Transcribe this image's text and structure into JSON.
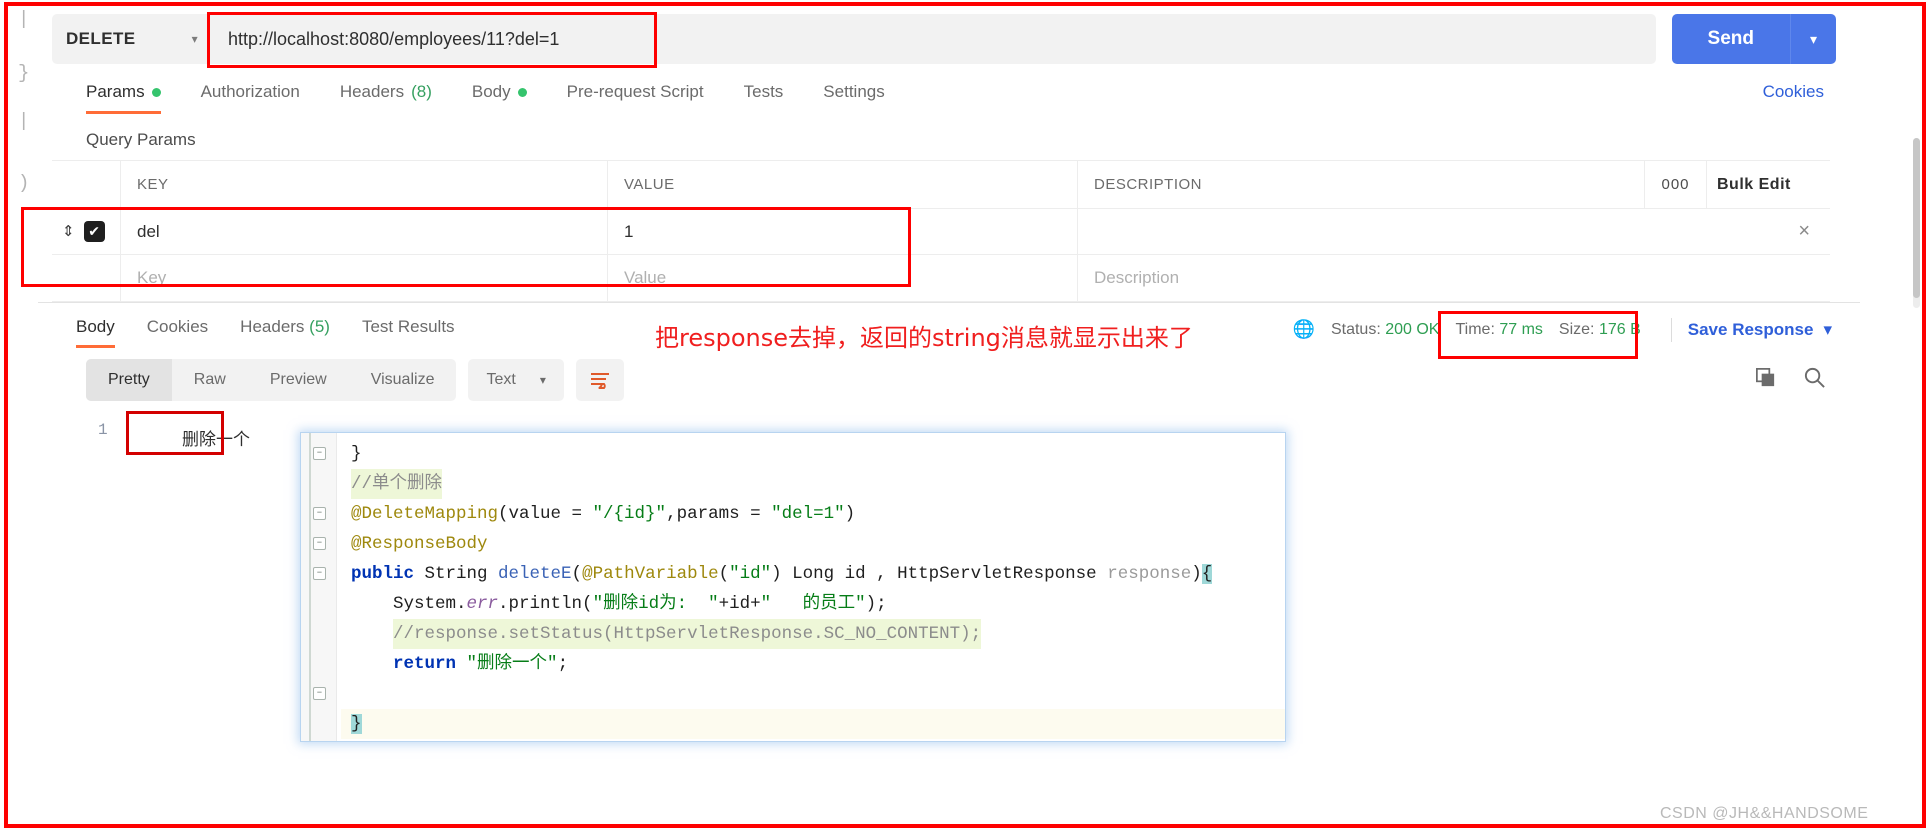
{
  "request": {
    "method": "DELETE",
    "method_caret": "chevron-down",
    "url": "http://localhost:8080/employees/11?del=1",
    "send_label": "Send",
    "tabs": [
      {
        "label": "Params",
        "badge": "dot",
        "active": true
      },
      {
        "label": "Authorization",
        "badge": "",
        "active": false
      },
      {
        "label": "Headers",
        "count": "(8)",
        "badge": "count",
        "active": false
      },
      {
        "label": "Body",
        "badge": "dot",
        "active": false
      },
      {
        "label": "Pre-request Script",
        "badge": "",
        "active": false
      },
      {
        "label": "Tests",
        "badge": "",
        "active": false
      },
      {
        "label": "Settings",
        "badge": "",
        "active": false
      }
    ],
    "cookies_link": "Cookies"
  },
  "query_params": {
    "section_title": "Query Params",
    "columns": {
      "key": "KEY",
      "value": "VALUE",
      "description": "DESCRIPTION"
    },
    "dots_label": "000",
    "bulk_edit_label": "Bulk Edit",
    "rows": [
      {
        "checked": true,
        "key": "del",
        "value": "1",
        "description": "",
        "remove": "×"
      }
    ],
    "placeholder_row": {
      "key": "Key",
      "value": "Value",
      "description": "Description"
    }
  },
  "response": {
    "tabs": [
      {
        "label": "Body",
        "active": true
      },
      {
        "label": "Cookies",
        "active": false
      },
      {
        "label": "Headers",
        "count": "(5)",
        "active": false
      },
      {
        "label": "Test Results",
        "active": false
      }
    ],
    "status": {
      "globe_icon": "globe-icon",
      "status_label": "Status:",
      "status_value": "200 OK",
      "time_label": "Time:",
      "time_value": "77 ms",
      "size_label": "Size:",
      "size_value": "176 B"
    },
    "save_response_label": "Save Response",
    "view_modes": [
      {
        "label": "Pretty",
        "active": true
      },
      {
        "label": "Raw",
        "active": false
      },
      {
        "label": "Preview",
        "active": false
      },
      {
        "label": "Visualize",
        "active": false
      }
    ],
    "format": "Text",
    "wrap_icon": "wrap-lines-icon",
    "copy_icon": "copy-icon",
    "search_icon": "search-icon",
    "body": {
      "line_number": "1",
      "text": "删除一个"
    }
  },
  "annotation": {
    "note": "把response去掉，返回的string消息就显示出来了"
  },
  "code_editor": {
    "lines": [
      {
        "tokens": [
          {
            "t": "}",
            "c": "plain"
          }
        ]
      },
      {
        "highlight": "green",
        "tokens": [
          {
            "t": "//单个删除",
            "c": "cmt"
          }
        ]
      },
      {
        "tokens": [
          {
            "t": "@DeleteMapping",
            "c": "ann"
          },
          {
            "t": "(value = ",
            "c": "plain"
          },
          {
            "t": "\"/{id}\"",
            "c": "str"
          },
          {
            "t": ",params = ",
            "c": "plain"
          },
          {
            "t": "\"del=1\"",
            "c": "str"
          },
          {
            "t": ")",
            "c": "plain"
          }
        ]
      },
      {
        "tokens": [
          {
            "t": "@ResponseBody",
            "c": "ann"
          }
        ]
      },
      {
        "tokens": [
          {
            "t": "public",
            "c": "kw"
          },
          {
            "t": " String ",
            "c": "plain"
          },
          {
            "t": "deleteE",
            "c": "meth"
          },
          {
            "t": "(",
            "c": "plain"
          },
          {
            "t": "@PathVariable",
            "c": "ann"
          },
          {
            "t": "(",
            "c": "plain"
          },
          {
            "t": "\"id\"",
            "c": "str"
          },
          {
            "t": ") Long id , HttpServletResponse ",
            "c": "plain"
          },
          {
            "t": "response",
            "c": "param"
          },
          {
            "t": ")",
            "c": "plain"
          },
          {
            "t": "{",
            "c": "caret"
          }
        ]
      },
      {
        "indent": 1,
        "tokens": [
          {
            "t": "System.",
            "c": "plain"
          },
          {
            "t": "err",
            "c": "fld"
          },
          {
            "t": ".println(",
            "c": "plain"
          },
          {
            "t": "\"删除id为:  \"",
            "c": "str"
          },
          {
            "t": "+id+",
            "c": "plain"
          },
          {
            "t": "\"   的员工\"",
            "c": "str"
          },
          {
            "t": ");",
            "c": "plain"
          }
        ]
      },
      {
        "indent": 1,
        "highlight": "green",
        "tokens": [
          {
            "t": "//response.setStatus(HttpServletResponse.SC_NO_CONTENT);",
            "c": "cmt"
          }
        ]
      },
      {
        "indent": 1,
        "tokens": [
          {
            "t": "return",
            "c": "kw"
          },
          {
            "t": " ",
            "c": "plain"
          },
          {
            "t": "\"删除一个\"",
            "c": "str"
          },
          {
            "t": ";",
            "c": "plain"
          }
        ]
      },
      {
        "tokens": []
      },
      {
        "row_highlight": "yellow",
        "tokens": [
          {
            "t": "}",
            "c": "caret"
          }
        ]
      }
    ]
  },
  "gutter_glyphs": [
    "|",
    "}",
    "|",
    ")"
  ],
  "watermark": "CSDN @JH&&HANDSOME"
}
